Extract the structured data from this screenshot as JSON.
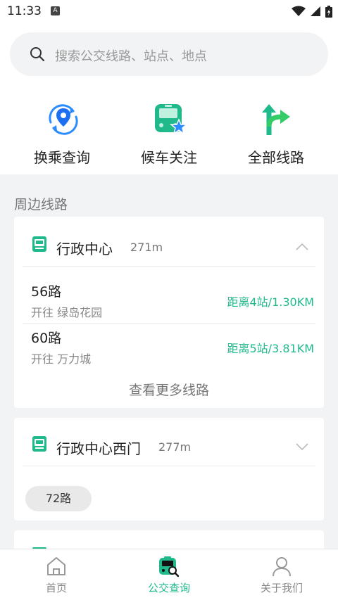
{
  "status": {
    "time": "11:33",
    "notif": "A"
  },
  "search": {
    "placeholder": "搜索公交线路、站点、地点"
  },
  "quick_actions": [
    {
      "label": "换乘查询",
      "icon": "transfer-location-icon"
    },
    {
      "label": "候车关注",
      "icon": "bus-star-icon"
    },
    {
      "label": "全部线路",
      "icon": "branch-arrow-icon"
    }
  ],
  "nearby": {
    "title": "周边线路",
    "stops": [
      {
        "name": "行政中心",
        "distance": "271m",
        "expanded": true,
        "routes": [
          {
            "name": "56路",
            "direction": "开往 绿岛花园",
            "far": "距离4站/1.30KM"
          },
          {
            "name": "60路",
            "direction": "开往 万力城",
            "far": "距离5站/3.81KM"
          }
        ],
        "more": "查看更多线路"
      },
      {
        "name": "行政中心西门",
        "distance": "277m",
        "expanded": false,
        "chips": [
          "72路"
        ]
      }
    ]
  },
  "tabs": [
    {
      "label": "首页",
      "icon": "home-icon",
      "active": false
    },
    {
      "label": "公交查询",
      "icon": "bus-search-icon",
      "active": true
    },
    {
      "label": "关于我们",
      "icon": "person-icon",
      "active": false
    }
  ],
  "colors": {
    "accent": "#1fb98c",
    "primary_blue": "#2a8cff",
    "background": "#f2f3f5"
  }
}
